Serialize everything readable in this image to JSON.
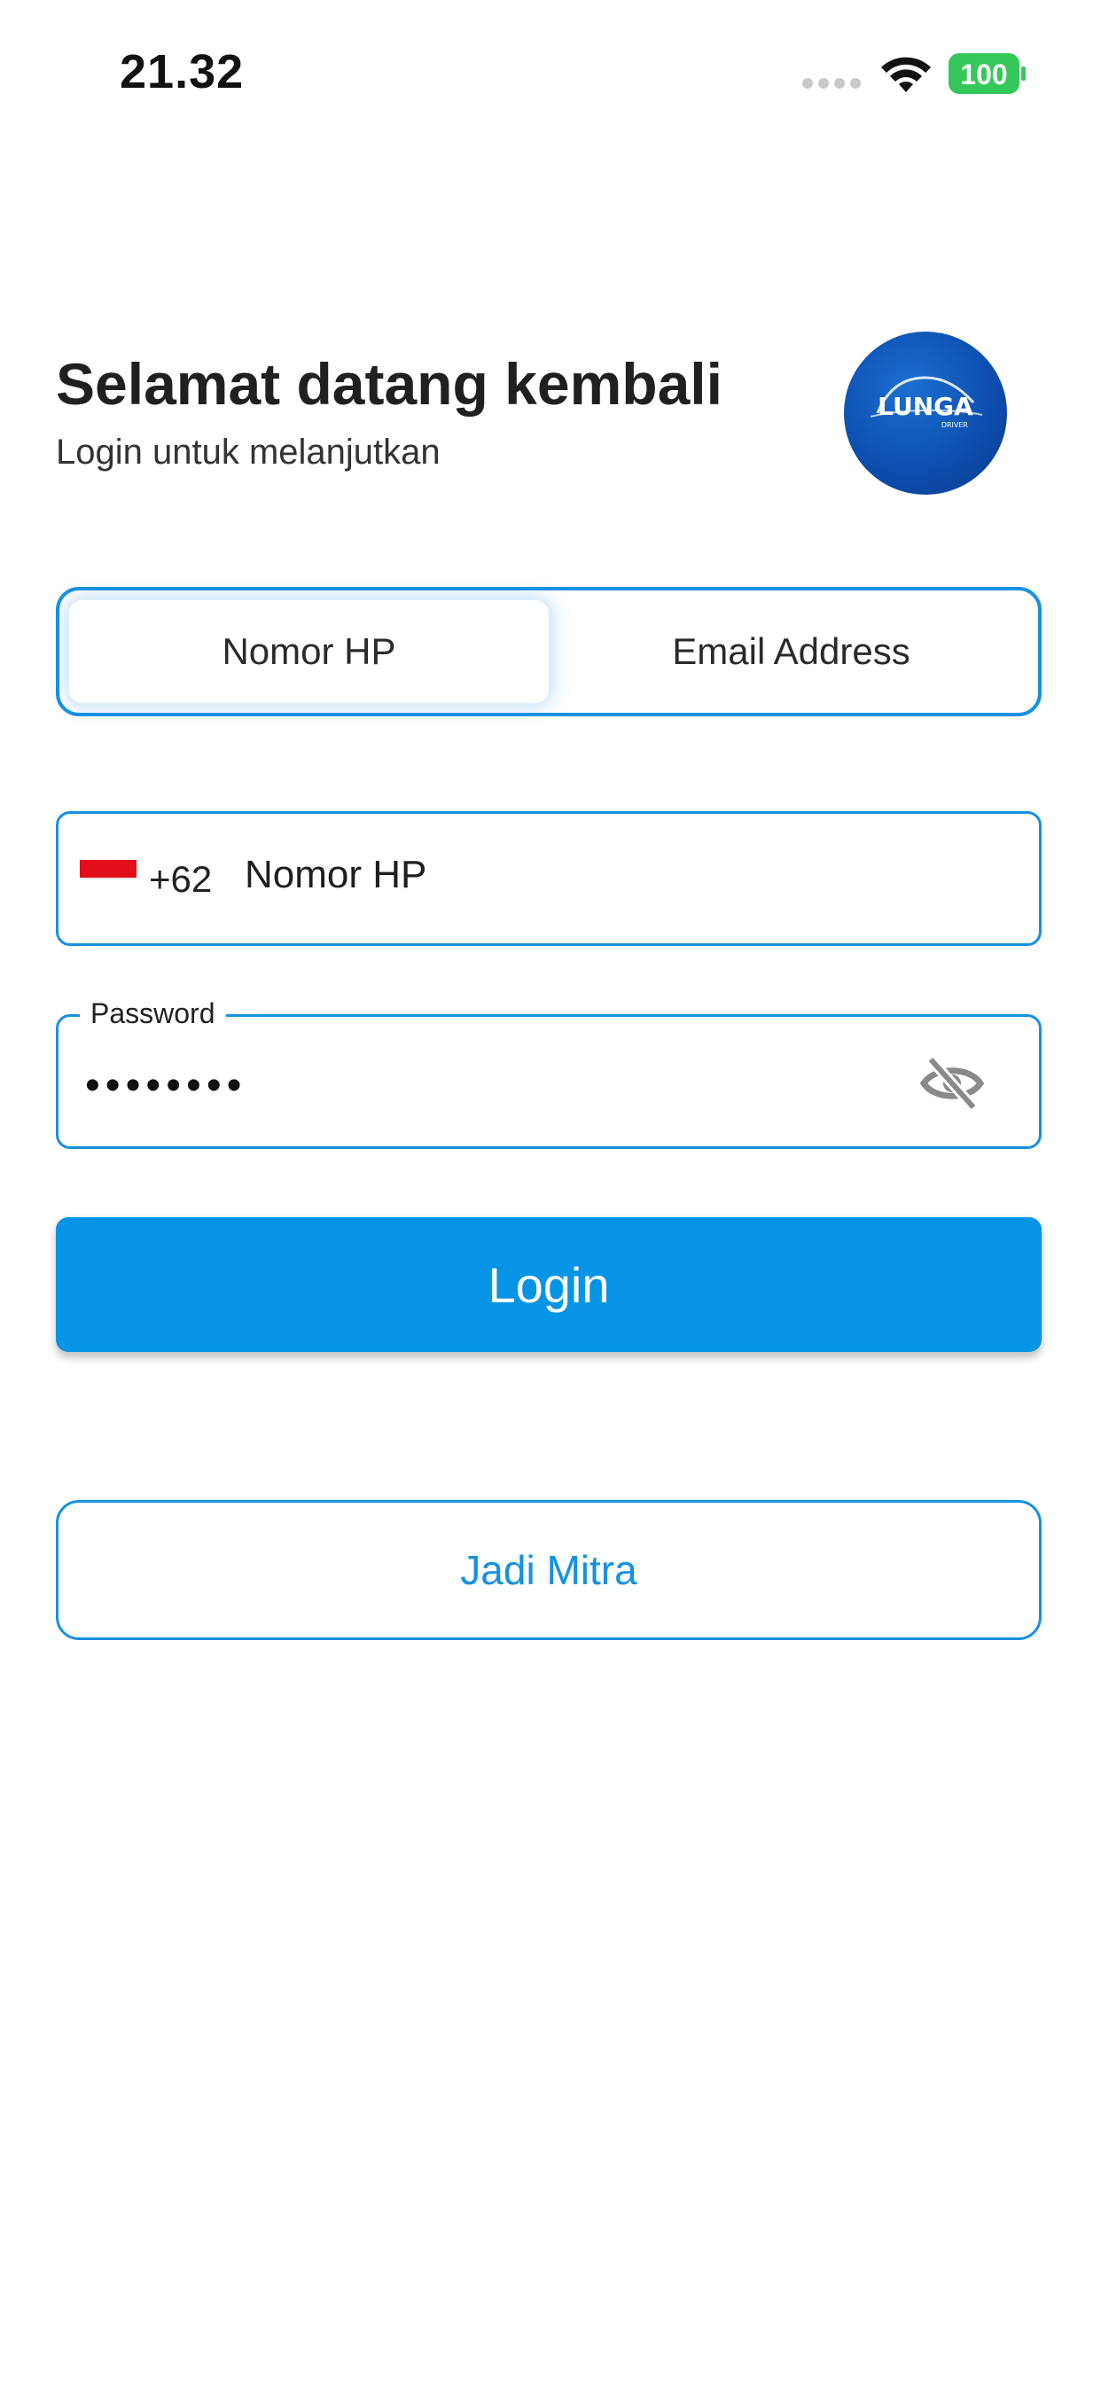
{
  "status_bar": {
    "time": "21.32",
    "battery": "100",
    "icons": [
      "signal-dots-icon",
      "wifi-icon",
      "battery-icon"
    ]
  },
  "header": {
    "title": "Selamat datang kembali",
    "subtitle": "Login untuk melanjutkan",
    "logo": {
      "text": "LUNGA",
      "sub": "DRIVER"
    }
  },
  "tabs": [
    {
      "label": "Nomor HP",
      "active": true
    },
    {
      "label": "Email Address",
      "active": false
    }
  ],
  "phone_field": {
    "country_code": "+62",
    "placeholder": "Nomor HP",
    "flag": "indonesia-flag-icon"
  },
  "password_field": {
    "label": "Password",
    "value": "••••••••",
    "toggle_icon": "eye-off-icon"
  },
  "buttons": {
    "login": "Login",
    "partner": "Jadi Mitra"
  },
  "colors": {
    "accent": "#0594e6",
    "border": "#1691e2",
    "battery": "#34c759"
  }
}
